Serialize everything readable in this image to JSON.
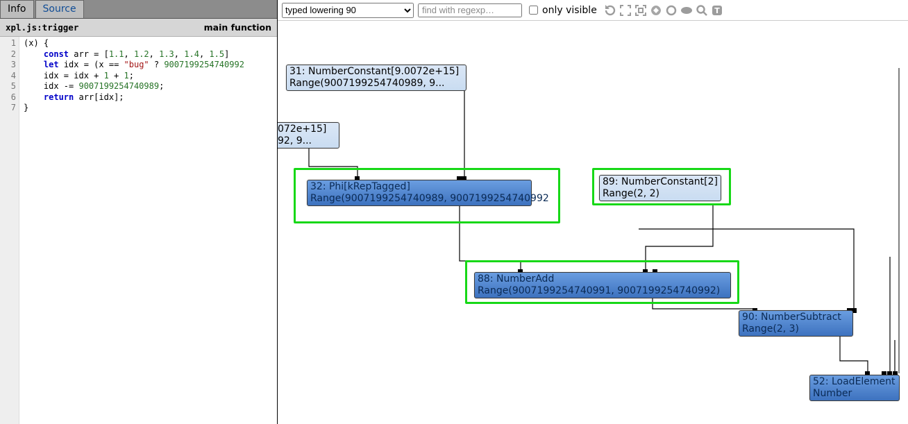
{
  "left": {
    "tabs": [
      "Info",
      "Source"
    ],
    "active_tab": 1,
    "file_name": "xpl.js:trigger",
    "file_fn": "main function",
    "lines": [
      "1",
      "2",
      "3",
      "4",
      "5",
      "6",
      "7"
    ]
  },
  "toolbar": {
    "phase_selected": "typed lowering 90",
    "search_placeholder": "find with regexp…",
    "only_visible_label": "only visible",
    "icons": {
      "refresh": "↻",
      "fit_all": "⤢",
      "fit_selection": "⤡",
      "show_values": "V",
      "show_outputs": "O",
      "show_types": "•",
      "search": "Q",
      "text": "T"
    }
  },
  "nodes": {
    "n31": {
      "l1": "31: NumberConstant[9.0072e+15]",
      "l2": "Range(9007199254740989, 9..."
    },
    "nCut": {
      "l1": "072e+15]",
      "l2": "92, 9..."
    },
    "n32": {
      "l1": "32: Phi[kRepTagged]",
      "l2": "Range(9007199254740989, 9007199254740992"
    },
    "n88": {
      "l1": "88: NumberAdd",
      "l2": "Range(9007199254740991, 9007199254740992)"
    },
    "n89": {
      "l1": "89: NumberConstant[2]",
      "l2": "Range(2, 2)"
    },
    "n90": {
      "l1": "90: NumberSubtract",
      "l2": "Range(2, 3)"
    },
    "n52": {
      "l1": "52: LoadElement",
      "l2": "Number"
    }
  },
  "chart_data": null
}
